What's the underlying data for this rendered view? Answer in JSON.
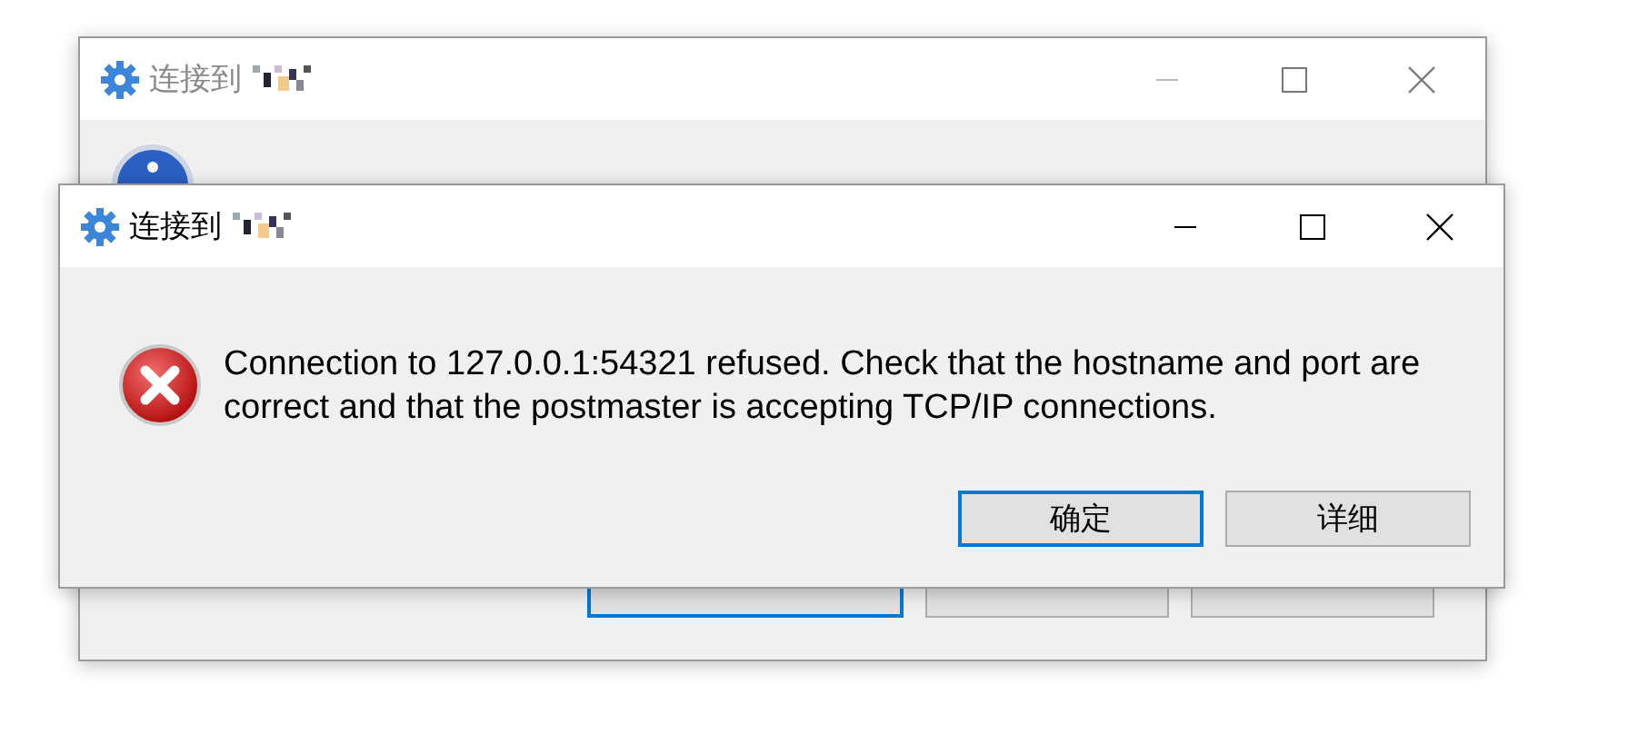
{
  "background_window": {
    "title": "连接到",
    "active": false,
    "buttons": [
      {
        "focused": true
      },
      {
        "focused": false
      },
      {
        "focused": false
      }
    ]
  },
  "error_dialog": {
    "title": "连接到",
    "active": true,
    "message": "Connection to 127.0.0.1:54321 refused. Check that the hostname and port are correct and that the postmaster is accepting TCP/IP connections.",
    "buttons": [
      {
        "label": "确定",
        "focused": true
      },
      {
        "label": "详细",
        "focused": false
      }
    ]
  }
}
